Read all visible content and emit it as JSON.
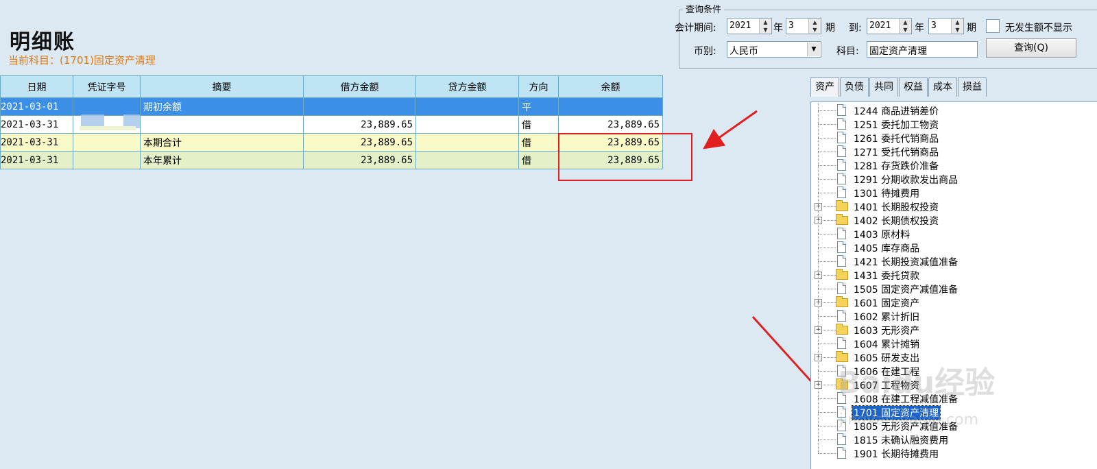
{
  "page": {
    "title": "明细账",
    "subtitle": "当前科目：(1701)固定资产清理"
  },
  "query": {
    "legend": "查询条件",
    "period_label": "会计期间:",
    "from_year": "2021",
    "year_unit": "年",
    "from_period": "3",
    "period_unit": "期",
    "to_label": "到:",
    "to_year": "2021",
    "to_period": "3",
    "hide_zero_label": "无发生额不显示",
    "currency_label": "币别:",
    "currency_value": "人民币",
    "account_label": "科目:",
    "account_value": "固定资产清理",
    "query_button": "查询(Q)"
  },
  "ledger": {
    "columns": [
      "日期",
      "凭证字号",
      "摘要",
      "借方金额",
      "贷方金额",
      "方向",
      "余额"
    ],
    "rows": [
      {
        "date": "2021-03-01",
        "voucher": "",
        "summary": "期初余额",
        "debit": "",
        "credit": "",
        "direction": "平",
        "balance": ""
      },
      {
        "date": "2021-03-31",
        "voucher": "",
        "summary": "",
        "debit": "23,889.65",
        "credit": "",
        "direction": "借",
        "balance": "23,889.65"
      },
      {
        "date": "2021-03-31",
        "voucher": "",
        "summary": "本期合计",
        "debit": "23,889.65",
        "credit": "",
        "direction": "借",
        "balance": "23,889.65"
      },
      {
        "date": "2021-03-31",
        "voucher": "",
        "summary": "本年累计",
        "debit": "23,889.65",
        "credit": "",
        "direction": "借",
        "balance": "23,889.65"
      }
    ]
  },
  "account_tabs": [
    "资产",
    "负债",
    "共同",
    "权益",
    "成本",
    "损益"
  ],
  "account_tree": [
    {
      "label": "1244  商品进销差价",
      "folder": false
    },
    {
      "label": "1251  委托加工物资",
      "folder": false
    },
    {
      "label": "1261  委托代销商品",
      "folder": false
    },
    {
      "label": "1271  受托代销商品",
      "folder": false
    },
    {
      "label": "1281  存货跌价准备",
      "folder": false
    },
    {
      "label": "1291  分期收款发出商品",
      "folder": false
    },
    {
      "label": "1301  待摊费用",
      "folder": false
    },
    {
      "label": "1401  长期股权投资",
      "folder": true
    },
    {
      "label": "1402  长期债权投资",
      "folder": true
    },
    {
      "label": "1403  原材料",
      "folder": false
    },
    {
      "label": "1405  库存商品",
      "folder": false
    },
    {
      "label": "1421  长期投资减值准备",
      "folder": false
    },
    {
      "label": "1431  委托贷款",
      "folder": true
    },
    {
      "label": "1505  固定资产减值准备",
      "folder": false
    },
    {
      "label": "1601  固定资产",
      "folder": true
    },
    {
      "label": "1602  累计折旧",
      "folder": false
    },
    {
      "label": "1603  无形资产",
      "folder": true
    },
    {
      "label": "1604  累计摊销",
      "folder": false
    },
    {
      "label": "1605  研发支出",
      "folder": true
    },
    {
      "label": "1606  在建工程",
      "folder": false
    },
    {
      "label": "1607  工程物资",
      "folder": true
    },
    {
      "label": "1608  在建工程减值准备",
      "folder": false
    },
    {
      "label": "1701  固定资产清理",
      "folder": false,
      "selected": true
    },
    {
      "label": "1805  无形资产减值准备",
      "folder": false
    },
    {
      "label": "1815  未确认融资费用",
      "folder": false
    },
    {
      "label": "1901  长期待摊费用",
      "folder": false
    }
  ],
  "watermark": {
    "main": "Baidu经验",
    "sub": "jingyan.baidu.com"
  },
  "colors": {
    "selected_row": "#3b8fe6",
    "header_bg": "#bfe5f5",
    "subtitle": "#e07a10",
    "annotation": "#e02020"
  }
}
